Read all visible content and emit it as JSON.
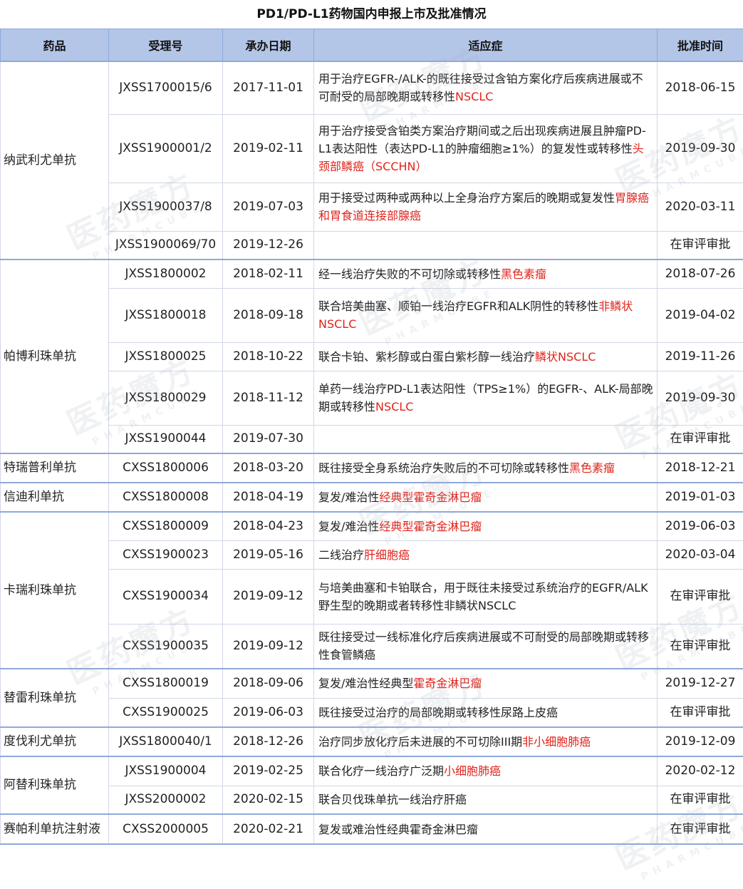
{
  "title": "PD1/PD-L1药物国内申报上市及批准情况",
  "headers": {
    "drug": "药品",
    "acceptance_no": "受理号",
    "date": "承办日期",
    "indication": "适应症",
    "approval": "批准时间"
  },
  "watermark": {
    "cn": "医药魔方",
    "en": "PHARMCUBE"
  },
  "colors": {
    "header_bg": "#b4c6e7",
    "highlight": "#e0241c"
  },
  "groups": [
    {
      "drug": "纳武利尤单抗",
      "rows": [
        {
          "no": "JXSS1700015/6",
          "date": "2017-11-01",
          "ind_plain": "用于治疗EGFR-/ALK-的既往接受过含铂方案化疗后疾病进展或不可耐受的局部晚期或转移性",
          "ind_red": "NSCLC",
          "approval": "2018-06-15"
        },
        {
          "no": "JXSS1900001/2",
          "date": "2019-02-11",
          "ind_plain": "用于治疗接受含铂类方案治疗期间或之后出现疾病进展且肿瘤PD-L1表达阳性（表达PD-L1的肿瘤细胞≥1%）的复发性或转移性",
          "ind_red": "头颈部鳞癌（SCCHN）",
          "approval": "2019-09-30"
        },
        {
          "no": "JXSS1900037/8",
          "date": "2019-07-03",
          "ind_plain": "用于接受过两种或两种以上全身治疗方案后的晚期或复发性",
          "ind_red": "胃腺癌和胃食道连接部腺癌",
          "approval": "2020-03-11"
        },
        {
          "no": "JXSS1900069/70",
          "date": "2019-12-26",
          "ind_plain": "",
          "ind_red": "",
          "approval": "在审评审批"
        }
      ]
    },
    {
      "drug": "帕博利珠单抗",
      "rows": [
        {
          "no": "JXSS1800002",
          "date": "2018-02-11",
          "ind_plain": "经一线治疗失败的不可切除或转移性",
          "ind_red": "黑色素瘤",
          "approval": "2018-07-26"
        },
        {
          "no": "JXSS1800018",
          "date": "2018-09-18",
          "ind_plain": "联合培美曲塞、顺铂一线治疗EGFR和ALK阴性的转移性",
          "ind_red": "非鳞状NSCLC",
          "approval": "2019-04-02"
        },
        {
          "no": "JXSS1800025",
          "date": "2018-10-22",
          "ind_plain": "联合卡铂、紫杉醇或白蛋白紫杉醇一线治疗",
          "ind_red": "鳞状NSCLC",
          "approval": "2019-11-26"
        },
        {
          "no": "JXSS1800029",
          "date": "2018-11-12",
          "ind_plain": "单药一线治疗PD-L1表达阳性（TPS≥1%）的EGFR-、ALK-局部晚期或转移性",
          "ind_red": "NSCLC",
          "approval": "2019-09-30"
        },
        {
          "no": "JXSS1900044",
          "date": "2019-07-30",
          "ind_plain": "",
          "ind_red": "",
          "approval": "在审评审批"
        }
      ]
    },
    {
      "drug": "特瑞普利单抗",
      "rows": [
        {
          "no": "CXSS1800006",
          "date": "2018-03-20",
          "ind_plain": "既往接受全身系统治疗失败后的不可切除或转移性",
          "ind_red": "黑色素瘤",
          "approval": "2018-12-21"
        }
      ]
    },
    {
      "drug": "信迪利单抗",
      "rows": [
        {
          "no": "CXSS1800008",
          "date": "2018-04-19",
          "ind_plain": "复发/难治性",
          "ind_red": "经典型霍奇金淋巴瘤",
          "approval": "2019-01-03"
        }
      ]
    },
    {
      "drug": "卡瑞利珠单抗",
      "rows": [
        {
          "no": "CXSS1800009",
          "date": "2018-04-23",
          "ind_plain": "复发/难治性",
          "ind_red": "经典型霍奇金淋巴瘤",
          "approval": "2019-06-03"
        },
        {
          "no": "CXSS1900023",
          "date": "2019-05-16",
          "ind_plain": "二线治疗",
          "ind_red": "肝细胞癌",
          "approval": "2020-03-04"
        },
        {
          "no": "CXSS1900034",
          "date": "2019-09-12",
          "ind_plain": "与培美曲塞和卡铂联合，用于既往未接受过系统治疗的EGFR/ALK野生型的晚期或者转移性非鳞状NSCLC",
          "ind_red": "",
          "approval": "在审评审批"
        },
        {
          "no": "CXSS1900035",
          "date": "2019-09-12",
          "ind_plain": "既往接受过一线标准化疗后疾病进展或不可耐受的局部晚期或转移性食管鳞癌",
          "ind_red": "",
          "approval": "在审评审批"
        }
      ]
    },
    {
      "drug": "替雷利珠单抗",
      "rows": [
        {
          "no": "CXSS1800019",
          "date": "2018-09-06",
          "ind_plain": "复发/难治性经典型",
          "ind_red": "霍奇金淋巴瘤",
          "approval": "2019-12-27"
        },
        {
          "no": "CXSS1900025",
          "date": "2019-06-03",
          "ind_plain": "既往接受过治疗的局部晚期或转移性尿路上皮癌",
          "ind_red": "",
          "approval": "在审评审批"
        }
      ]
    },
    {
      "drug": "度伐利尤单抗",
      "rows": [
        {
          "no": "JXSS1800040/1",
          "date": "2018-12-26",
          "ind_plain": "治疗同步放化疗后未进展的不可切除III期",
          "ind_red": "非小细胞肺癌",
          "approval": "2019-12-09"
        }
      ]
    },
    {
      "drug": "阿替利珠单抗",
      "rows": [
        {
          "no": "JXSS1900004",
          "date": "2019-02-25",
          "ind_plain": "联合化疗一线治疗广泛期",
          "ind_red": "小细胞肺癌",
          "approval": "2020-02-12"
        },
        {
          "no": "JXSS2000002",
          "date": "2020-02-15",
          "ind_plain": "联合贝伐珠单抗一线治疗肝癌",
          "ind_red": "",
          "approval": "在审评审批"
        }
      ]
    },
    {
      "drug": "赛帕利单抗注射液",
      "rows": [
        {
          "no": "CXSS2000005",
          "date": "2020-02-21",
          "ind_plain": "复发或难治性经典霍奇金淋巴瘤",
          "ind_red": "",
          "approval": "在审评审批"
        }
      ]
    }
  ]
}
